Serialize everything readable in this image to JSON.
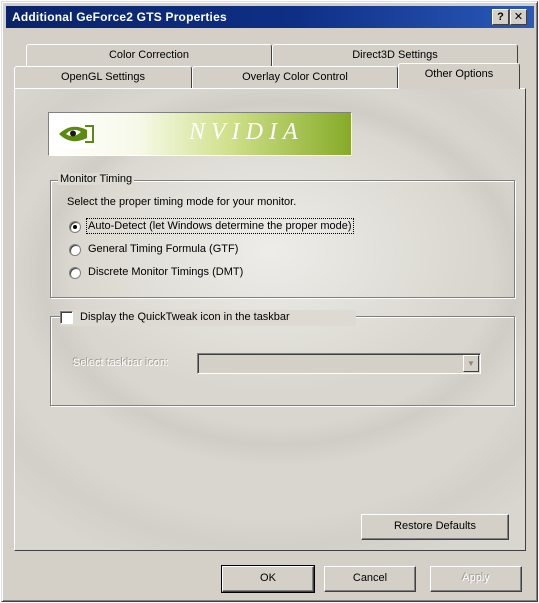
{
  "window": {
    "title": "Additional GeForce2 GTS Properties",
    "help_glyph": "?",
    "close_glyph": "✕"
  },
  "tabs": {
    "back_row": [
      "Color Correction",
      "Direct3D Settings"
    ],
    "front_row": [
      "OpenGL Settings",
      "Overlay Color Control",
      "Other Options"
    ],
    "active": "Other Options"
  },
  "banner": {
    "brand_text": "NVIDIA",
    "colors": {
      "start": "#ffffff",
      "end": "#86ab28",
      "logo": "#5a8a10"
    }
  },
  "monitor_timing": {
    "group_label": "Monitor Timing",
    "instructions": "Select the proper timing mode for your monitor.",
    "options": [
      {
        "label": "Auto-Detect (let Windows determine the proper mode)",
        "selected": true
      },
      {
        "label": "General Timing Formula (GTF)",
        "selected": false
      },
      {
        "label": "Discrete Monitor Timings (DMT)",
        "selected": false
      }
    ]
  },
  "quicktweak": {
    "checkbox_label": "Display the QuickTweak icon in the taskbar",
    "checked": false,
    "select_label": "Select taskbar icon:",
    "select_value": ""
  },
  "buttons": {
    "restore_defaults": "Restore Defaults",
    "ok": "OK",
    "cancel": "Cancel",
    "apply": "Apply"
  },
  "colors": {
    "titlebar": "#0a246a",
    "face": "#d4d0c8"
  }
}
